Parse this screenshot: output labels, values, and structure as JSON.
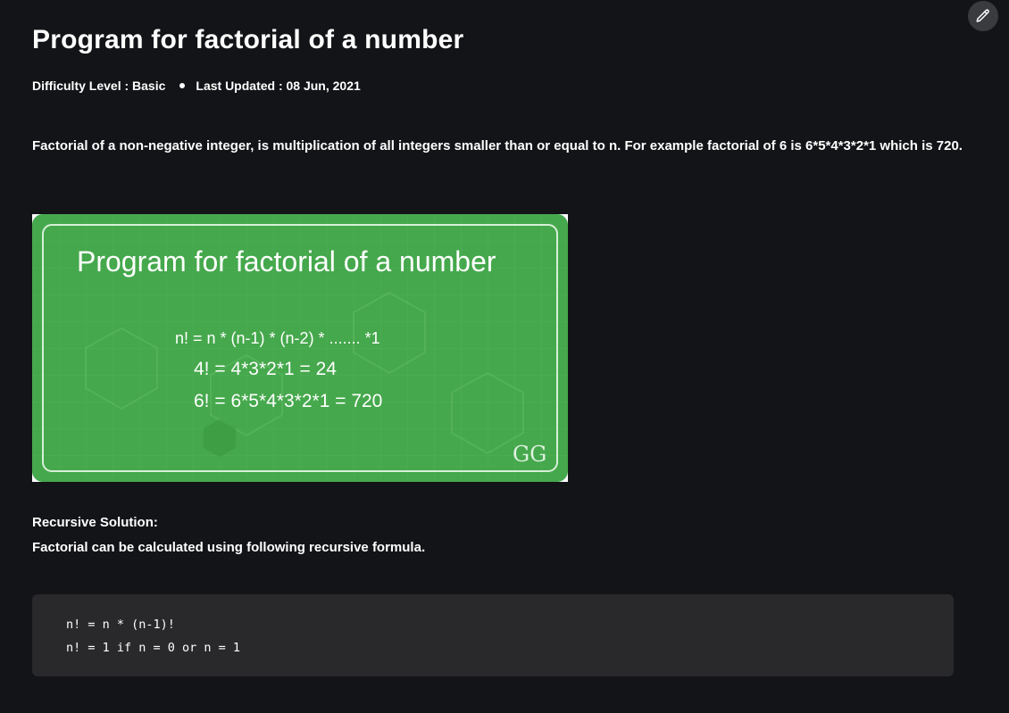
{
  "article": {
    "title": "Program for factorial of a number",
    "difficulty": "Difficulty Level : Basic",
    "last_updated": "Last Updated : 08 Jun, 2021",
    "intro": "Factorial of a non-negative integer, is multiplication of all integers smaller than or equal to n. For example factorial of 6 is 6*5*4*3*2*1 which is 720."
  },
  "figure": {
    "title": "Program for factorial of a number",
    "formula": "n! = n * (n-1) * (n-2) * ....... *1",
    "example1": "4! = 4*3*2*1 = 24",
    "example2": "6! = 6*5*4*3*2*1 = 720",
    "logo": "GG",
    "colors": {
      "background": "#45a84c",
      "border": "#d8efd9"
    }
  },
  "recursive": {
    "heading": "Recursive Solution:",
    "description": "Factorial can be calculated using following recursive formula."
  },
  "code": {
    "lines": [
      "n! = n * (n-1)!",
      "n! = 1 if n = 0 or n = 1"
    ]
  },
  "toolbar": {
    "edit_icon": "pencil-icon"
  },
  "theme": {
    "background": "#131417",
    "code_background": "#29292c",
    "text": "#ffffff"
  }
}
